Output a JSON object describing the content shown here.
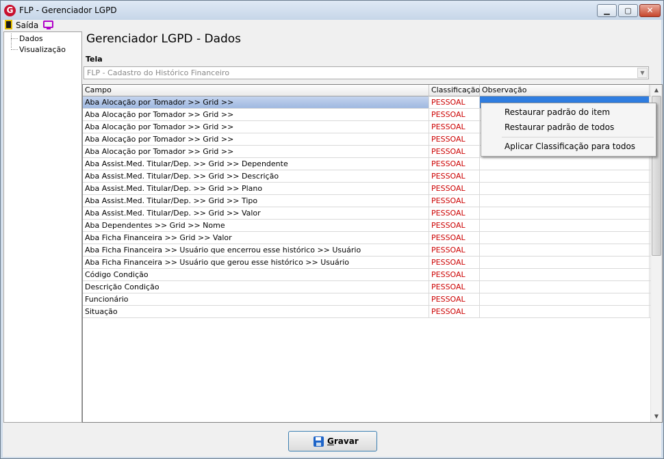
{
  "window": {
    "title": "FLP - Gerenciador LGPD",
    "logo_letter": "G",
    "minimize_glyph": "▁",
    "maximize_glyph": "▢",
    "close_glyph": "✕"
  },
  "toolbar": {
    "exit_label": "Saída",
    "exit_icon": "door-exit-icon",
    "screen_icon": "monitor-icon"
  },
  "tree": {
    "items": [
      {
        "label": "Dados"
      },
      {
        "label": "Visualização"
      }
    ]
  },
  "main": {
    "title": "Gerenciador LGPD - Dados",
    "tela_label": "Tela",
    "tela_value": "FLP - Cadastro do Histórico Financeiro"
  },
  "grid": {
    "columns": [
      "Campo",
      "Classificação",
      "Observação"
    ],
    "rows": [
      {
        "campo": "Aba Alocação por Tomador >> Grid >>",
        "classificacao": "PESSOAL",
        "observacao": ""
      },
      {
        "campo": "Aba Alocação por Tomador >> Grid >>",
        "classificacao": "PESSOAL",
        "observacao": ""
      },
      {
        "campo": "Aba Alocação por Tomador >> Grid >>",
        "classificacao": "PESSOAL",
        "observacao": ""
      },
      {
        "campo": "Aba Alocação por Tomador >> Grid >>",
        "classificacao": "PESSOAL",
        "observacao": ""
      },
      {
        "campo": "Aba Alocação por Tomador >> Grid >>",
        "classificacao": "PESSOAL",
        "observacao": ""
      },
      {
        "campo": "Aba Assist.Med. Titular/Dep. >> Grid >> Dependente",
        "classificacao": "PESSOAL",
        "observacao": ""
      },
      {
        "campo": "Aba Assist.Med. Titular/Dep. >> Grid >> Descrição",
        "classificacao": "PESSOAL",
        "observacao": ""
      },
      {
        "campo": "Aba Assist.Med. Titular/Dep. >> Grid >> Plano",
        "classificacao": "PESSOAL",
        "observacao": ""
      },
      {
        "campo": "Aba Assist.Med. Titular/Dep. >> Grid >> Tipo",
        "classificacao": "PESSOAL",
        "observacao": ""
      },
      {
        "campo": "Aba Assist.Med. Titular/Dep. >> Grid >> Valor",
        "classificacao": "PESSOAL",
        "observacao": ""
      },
      {
        "campo": "Aba Dependentes >> Grid >> Nome",
        "classificacao": "PESSOAL",
        "observacao": ""
      },
      {
        "campo": "Aba Ficha Financeira >> Grid >> Valor",
        "classificacao": "PESSOAL",
        "observacao": ""
      },
      {
        "campo": "Aba Ficha Financeira >> Usuário que encerrou esse histórico >> Usuário",
        "classificacao": "PESSOAL",
        "observacao": ""
      },
      {
        "campo": "Aba Ficha Financeira >> Usuário que gerou esse histórico >> Usuário",
        "classificacao": "PESSOAL",
        "observacao": ""
      },
      {
        "campo": "Código Condição",
        "classificacao": "PESSOAL",
        "observacao": ""
      },
      {
        "campo": "Descrição Condição",
        "classificacao": "PESSOAL",
        "observacao": ""
      },
      {
        "campo": "Funcionário",
        "classificacao": "PESSOAL",
        "observacao": ""
      },
      {
        "campo": "Situação",
        "classificacao": "PESSOAL",
        "observacao": ""
      }
    ],
    "selected_row": 0
  },
  "context_menu": {
    "items": [
      "Restaurar padrão do item",
      "Restaurar padrão de todos",
      "Aplicar Classificação para todos"
    ]
  },
  "footer": {
    "save_label": "Gravar",
    "save_icon": "floppy-disk-icon"
  },
  "colors": {
    "classification_text": "#cc0000",
    "selection": "#2f7de0",
    "save_border": "#3c7fb1"
  }
}
